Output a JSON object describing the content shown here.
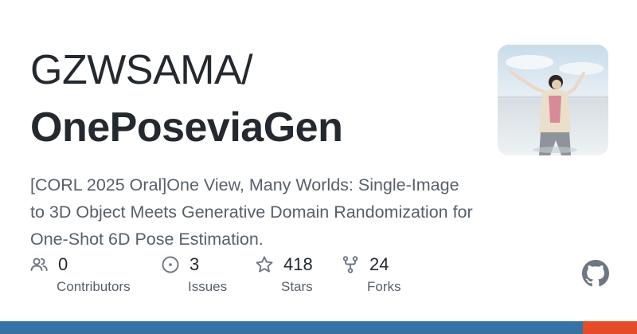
{
  "repo": {
    "owner": "GZWSAMA/",
    "name": "OnePoseviaGen",
    "description": "[CORL 2025 Oral]One View, Many Worlds: Single-Image to 3D Object Meets Generative Domain Randomization for One-Shot 6D Pose Estimation."
  },
  "stats": {
    "contributors": {
      "value": "0",
      "label": "Contributors",
      "icon": "people-icon"
    },
    "issues": {
      "value": "3",
      "label": "Issues",
      "icon": "issue-opened-icon"
    },
    "stars": {
      "value": "418",
      "label": "Stars",
      "icon": "star-icon"
    },
    "forks": {
      "value": "24",
      "label": "Forks",
      "icon": "repo-forked-icon"
    }
  },
  "language_bar": [
    {
      "color": "#3572A5",
      "fraction": 0.915
    },
    {
      "color": "#e34c26",
      "fraction": 0.085
    }
  ],
  "colors": {
    "title": "#24292f",
    "muted": "#57606a",
    "icon": "#6e7781"
  },
  "logo": "github-mark-icon"
}
